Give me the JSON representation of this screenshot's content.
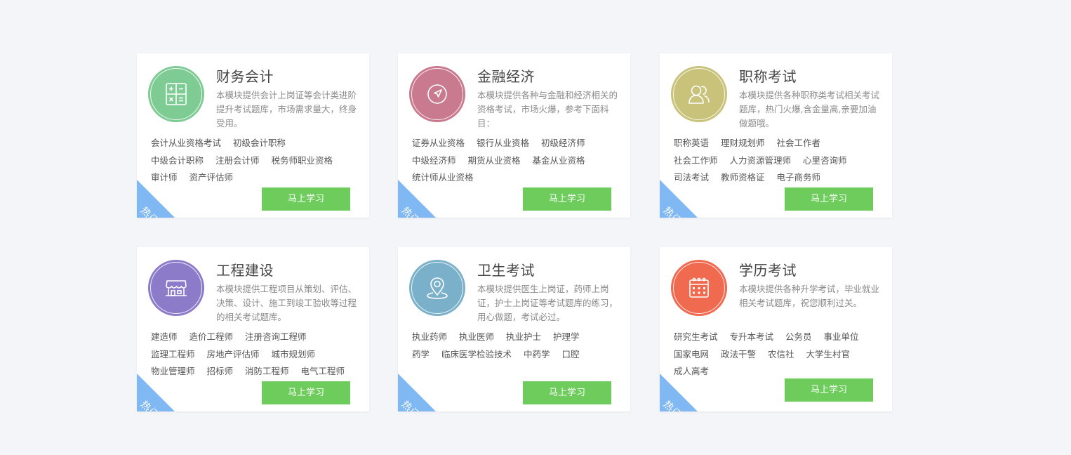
{
  "colors": {
    "background": "#f4f5f9",
    "button": "#6dcc5b",
    "hot_corner": "#7fb8f2"
  },
  "cards": [
    {
      "icon": "calculator-icon",
      "icon_color": "#7ecb94",
      "title": "财务会计",
      "desc": "本模块提供会计上岗证等会计类进阶提升考试题库，市场需求量大，终身受用。",
      "tags": [
        "会计从业资格考试",
        "初级会计职称",
        "中级会计职称",
        "注册会计师",
        "税务师职业资格",
        "审计师",
        "资产评估师"
      ],
      "button": "马上学习",
      "badge": "热门"
    },
    {
      "icon": "compass-icon",
      "icon_color": "#c97a8f",
      "title": "金融经济",
      "desc": "本模块提供各种与金融和经济相关的资格考试，市场火爆，参考下面科目：",
      "tags": [
        "证券从业资格",
        "银行从业资格",
        "初级经济师",
        "中级经济师",
        "期货从业资格",
        "基金从业资格",
        "统计师从业资格"
      ],
      "button": "马上学习",
      "badge": "热门"
    },
    {
      "icon": "users-icon",
      "icon_color": "#c9c27a",
      "title": "职称考试",
      "desc": "本模块提供各种职称类考试相关考试题库，热门火爆,含金量高,亲要加油做题哦。",
      "tags": [
        "职称英语",
        "理财规划师",
        "社会工作者",
        "社会工作师",
        "人力资源管理师",
        "心里咨询师",
        "司法考试",
        "教师资格证",
        "电子商务师"
      ],
      "button": "马上学习",
      "badge": "热门"
    },
    {
      "icon": "shop-icon",
      "icon_color": "#8b7bc9",
      "title": "工程建设",
      "desc": "本模块提供工程项目从策划、评估、决策、设计、施工到竣工验收等过程的相关考试题库。",
      "tags": [
        "建造师",
        "造价工程师",
        "注册咨询工程师",
        "监理工程师",
        "房地产评估师",
        "城市规划师",
        "物业管理师",
        "招标师",
        "消防工程师",
        "电气工程师"
      ],
      "button": "马上学习",
      "badge": "热门"
    },
    {
      "icon": "location-pin-icon",
      "icon_color": "#7ab0c9",
      "title": "卫生考试",
      "desc": "本模块提供医生上岗证，药师上岗证，护士上岗证等考试题库的练习，用心做题，考试必过。",
      "tags": [
        "执业药师",
        "执业医师",
        "执业护士",
        "护理学",
        "药学",
        "临床医学检验技术",
        "中药学",
        "口腔"
      ],
      "button": "马上学习",
      "badge": "热门"
    },
    {
      "icon": "calendar-icon",
      "icon_color": "#ef6a4f",
      "title": "学历考试",
      "desc": "本模块提供各种升学考试，毕业就业相关考试题库，祝您顺利过关。",
      "tags": [
        "研究生考试",
        "专升本考试",
        "公务员",
        "事业单位",
        "国家电网",
        "政法干警",
        "农信社",
        "大学生村官",
        "成人高考"
      ],
      "button": "马上学习",
      "badge": "热门"
    }
  ]
}
